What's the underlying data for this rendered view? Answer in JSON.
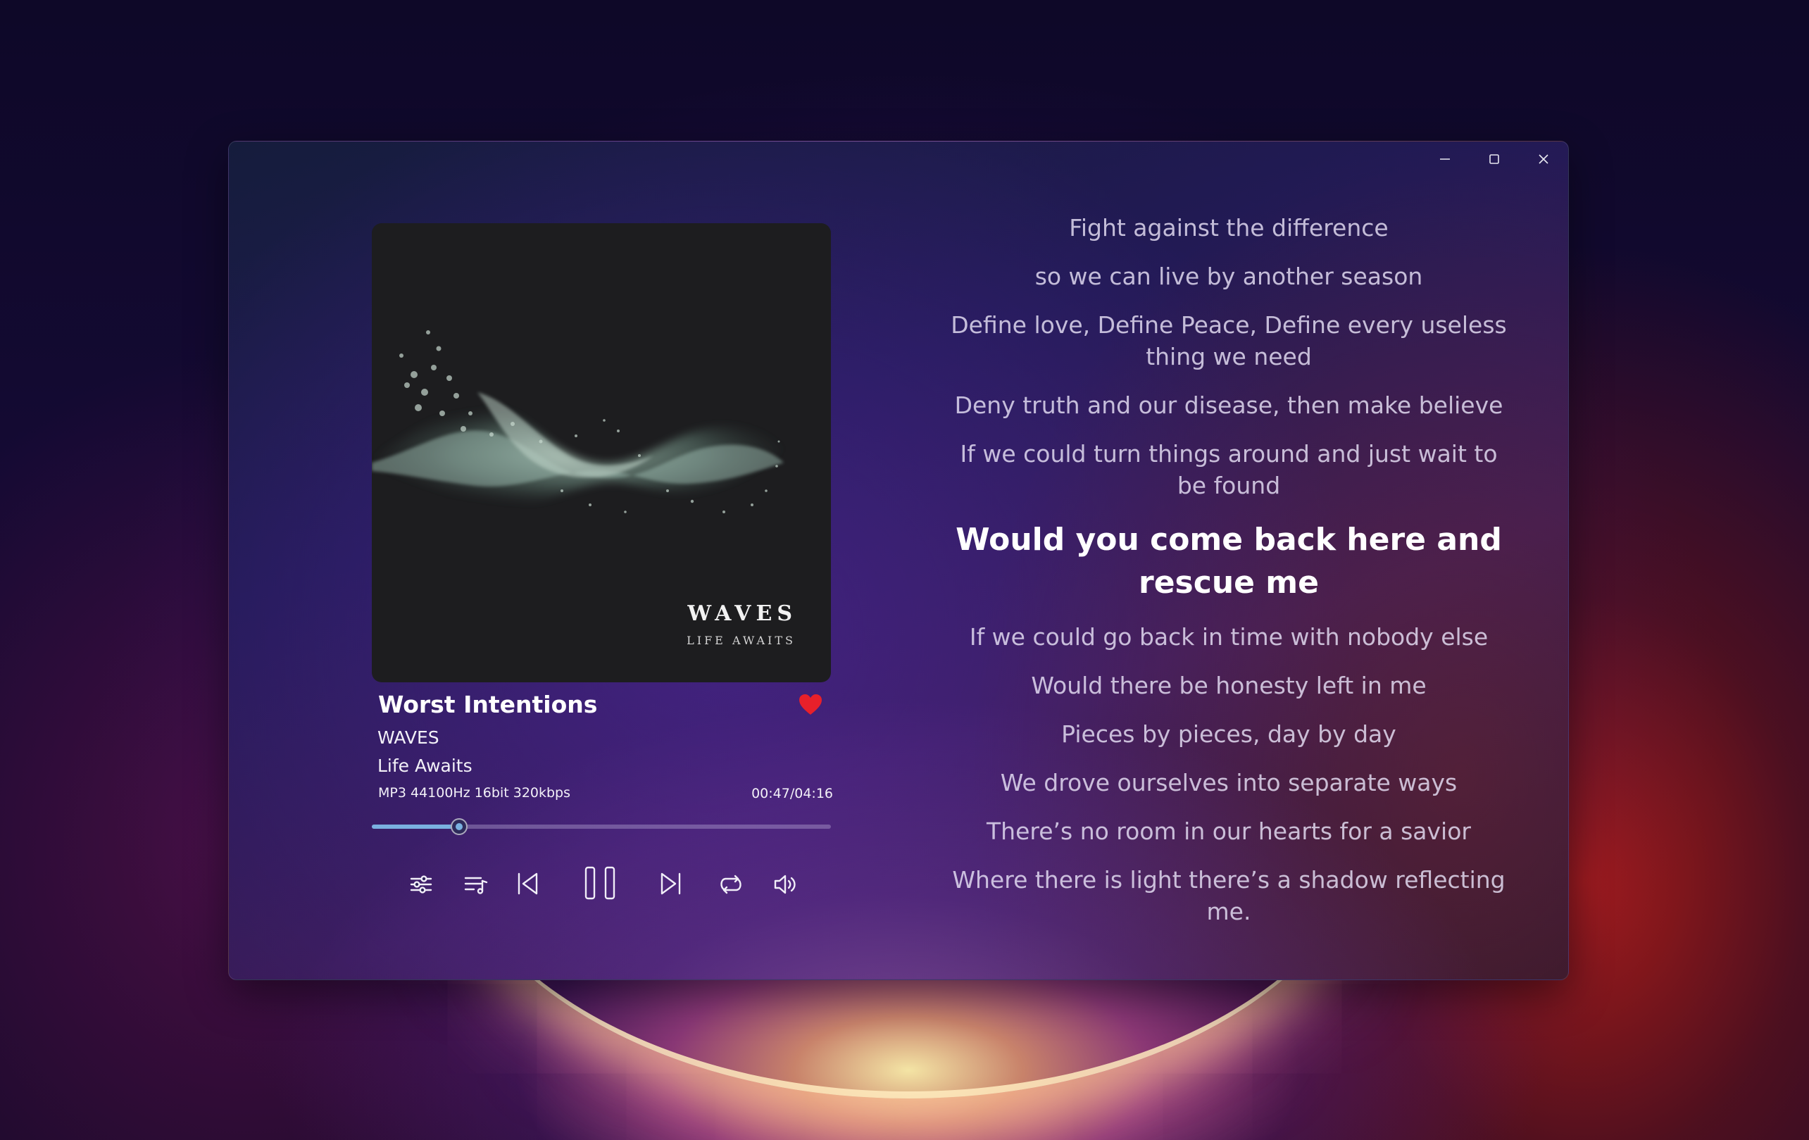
{
  "window": {
    "controls": {
      "minimize": "minimize-icon",
      "maximize": "maximize-icon",
      "close": "close-icon"
    }
  },
  "album_art": {
    "title": "WAVES",
    "subtitle": "LIFE AWAITS"
  },
  "track": {
    "title": "Worst Intentions",
    "artist": "WAVES",
    "album": "Life Awaits",
    "format": "MP3 44100Hz 16bit 320kbps",
    "time": "00:47/04:16",
    "progress_fraction": 0.19,
    "favorite": true
  },
  "controls": {
    "equalizer": "equalizer-icon",
    "playlist": "playlist-icon",
    "previous": "previous-icon",
    "pause": "pause-icon",
    "next": "next-icon",
    "repeat": "repeat-icon",
    "volume": "volume-icon"
  },
  "colors": {
    "accent": "#7ab0e0",
    "heart": "#e8202a"
  },
  "lyrics": {
    "lines": [
      "Fight against the difference",
      "so we can live by another season",
      "Define love, Define Peace, Define every useless thing we need",
      "Deny truth and our disease, then make believe",
      "If we could turn things around and just wait to be found",
      "Would you come back here and rescue me",
      "If we could go back in time with nobody else",
      "Would there be honesty left in me",
      "Pieces by pieces, day by day",
      "We drove ourselves into separate ways",
      "There’s no room in our hearts for a savior",
      "Where there is light there’s a shadow reflecting me."
    ],
    "current_index": 5
  }
}
